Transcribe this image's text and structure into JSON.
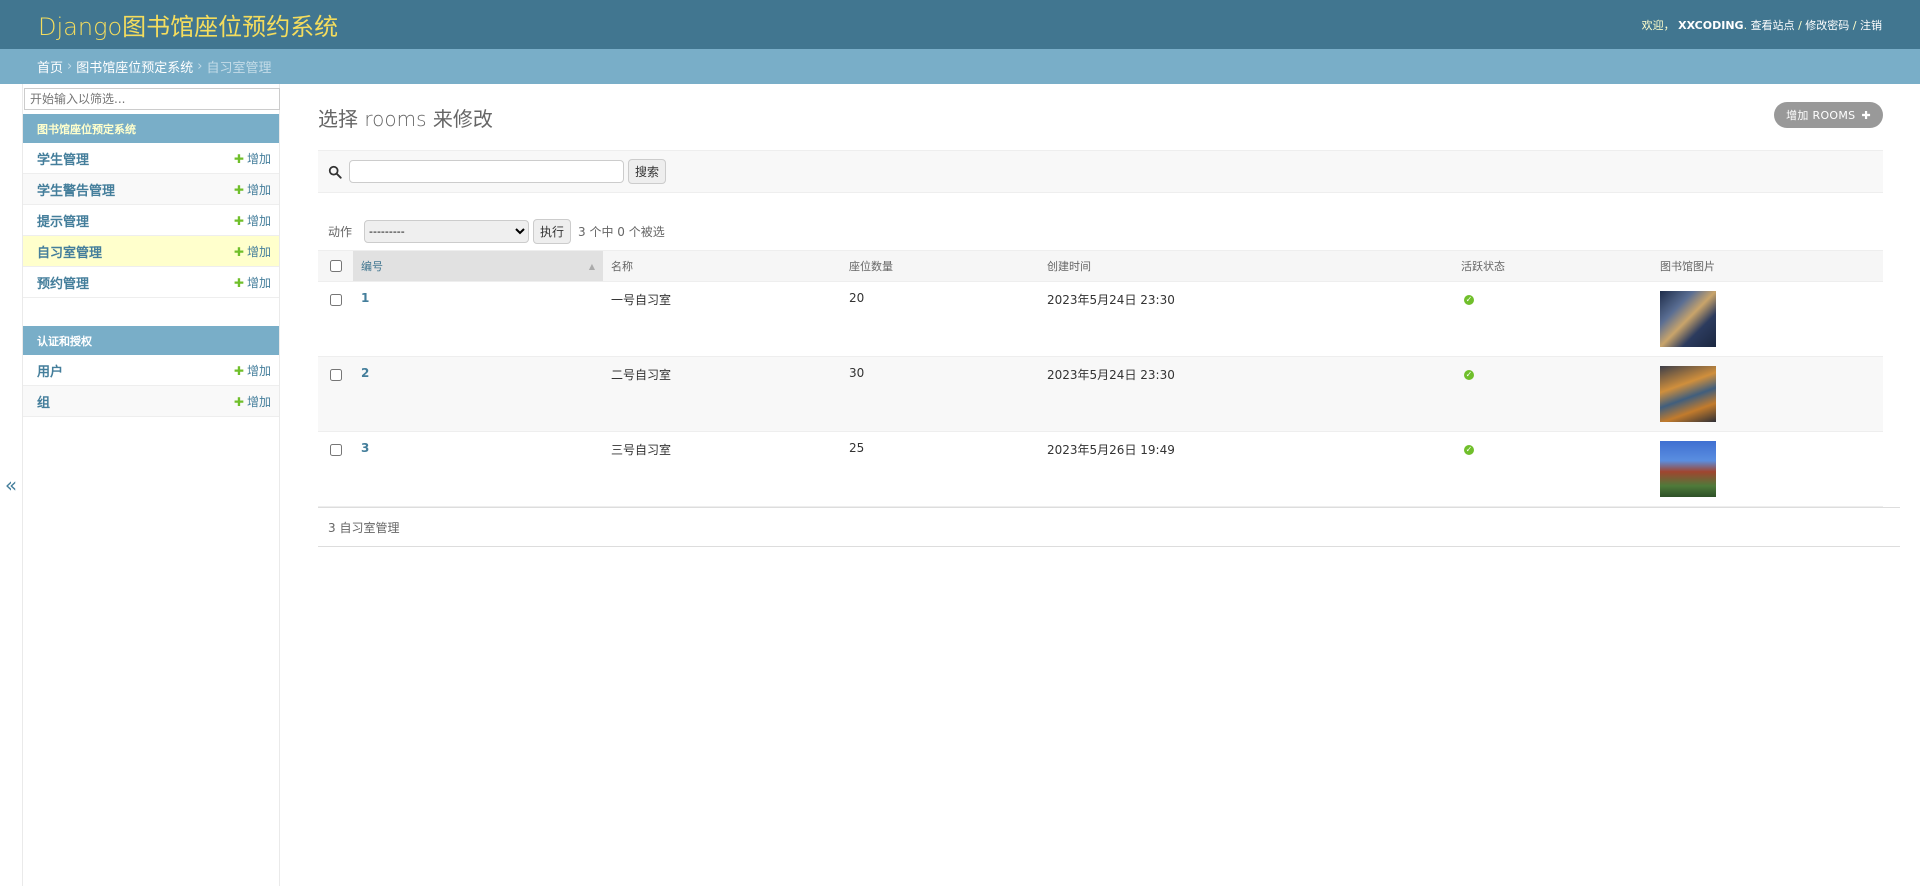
{
  "header": {
    "brand": "Django图书馆座位预约系统",
    "welcome": "欢迎，",
    "username": "XXCODING",
    "view_site": "查看站点",
    "change_password": "修改密码",
    "logout": "注销",
    "sep": "/"
  },
  "breadcrumbs": {
    "home": "首页",
    "app": "图书馆座位预定系统",
    "current": "自习室管理",
    "sep": "›"
  },
  "sidebar": {
    "filter_placeholder": "开始输入以筛选...",
    "toggle": "«",
    "modules": [
      {
        "caption": "图书馆座位预定系统",
        "items": [
          {
            "name": "学生管理",
            "add": "增加"
          },
          {
            "name": "学生警告管理",
            "add": "增加"
          },
          {
            "name": "提示管理",
            "add": "增加"
          },
          {
            "name": "自习室管理",
            "add": "增加"
          },
          {
            "name": "预约管理",
            "add": "增加"
          }
        ]
      },
      {
        "caption": "认证和授权",
        "items": [
          {
            "name": "用户",
            "add": "增加"
          },
          {
            "name": "组",
            "add": "增加"
          }
        ]
      }
    ]
  },
  "content": {
    "title": "选择 rooms 来修改",
    "add_button": "增加 ROOMS",
    "search_button": "搜索",
    "actions_label": "动作",
    "actions_selected": "---------",
    "run_button": "执行",
    "selection_count": "3 个中 0 个被选",
    "columns": [
      "编号",
      "名称",
      "座位数量",
      "创建时间",
      "活跃状态",
      "图书馆图片"
    ],
    "rows": [
      {
        "id": "1",
        "name": "一号自习室",
        "seats": "20",
        "created": "2023年5月24日 23:30",
        "active": true
      },
      {
        "id": "2",
        "name": "二号自习室",
        "seats": "30",
        "created": "2023年5月24日 23:30",
        "active": true
      },
      {
        "id": "3",
        "name": "三号自习室",
        "seats": "25",
        "created": "2023年5月26日 19:49",
        "active": true
      }
    ],
    "paginator": "3 自习室管理"
  },
  "colors": {
    "header_bg": "#417690",
    "breadcrumb_bg": "#79aec8",
    "brand_text": "#f5dd5d",
    "link": "#447e9b",
    "add_plus": "#70bf2b",
    "current_row": "#ffffcc"
  }
}
